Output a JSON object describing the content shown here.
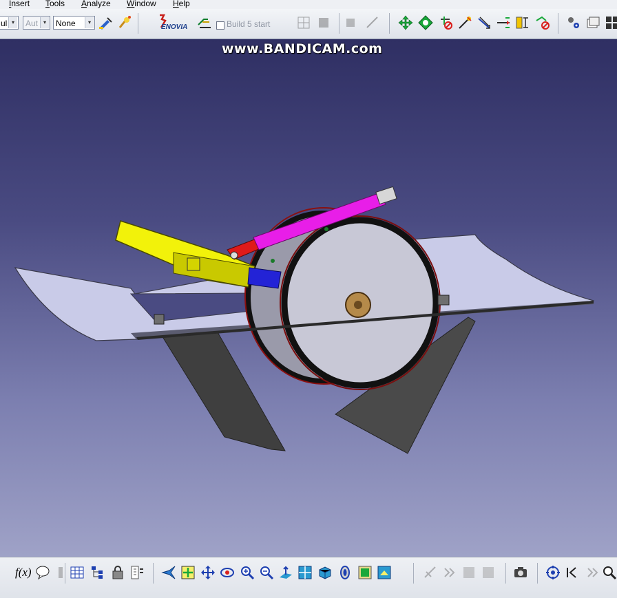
{
  "watermark": "www.BANDICAM.com",
  "menu": {
    "items": [
      {
        "label": "Insert",
        "underline": "I",
        "rest": "nsert"
      },
      {
        "label": "Tools",
        "underline": "T",
        "rest": "ools"
      },
      {
        "label": "Analyze",
        "underline": "A",
        "rest": "nalyze"
      },
      {
        "label": "Window",
        "underline": "W",
        "rest": "indow"
      },
      {
        "label": "Help",
        "underline": "H",
        "rest": "elp"
      }
    ]
  },
  "toolbar": {
    "combo1": "ul",
    "combo2": "Aut",
    "combo3": "None",
    "combo_arrow": "▾",
    "check_label": "Build 5 start"
  },
  "bottom_toolbar": {
    "formula_label": "f(x)"
  },
  "icons": [
    "painter-icon",
    "sweep-icon",
    "enovia-logo-icon",
    "snap-icon",
    "grid-icon",
    "compass-icon",
    "manipulate-icon",
    "explode-icon",
    "clash-icon",
    "measure-icon",
    "section-icon",
    "snapshot-icon",
    "parameters-icon",
    "formula-icon",
    "comment-icon",
    "table-icon",
    "tree-icon",
    "lock-icon",
    "fly-icon",
    "fit-all-icon",
    "pan-icon",
    "rotate-icon",
    "zoom-in-icon",
    "zoom-out-icon",
    "normal-view-icon",
    "iso-view-icon",
    "render-style-icon",
    "hide-show-icon",
    "swap-icon",
    "camera-icon",
    "target-icon"
  ],
  "colors": {
    "viewport_top": "#2f2f63",
    "viewport_bottom": "#9fa2c7",
    "yellow_arm": "#f2f20a",
    "magenta_cylinder": "#e81ee8",
    "red_part": "#e01a1a",
    "blue_part": "#2323d6",
    "plate": "#c9cbe8",
    "fin": "#3c3c3c"
  }
}
